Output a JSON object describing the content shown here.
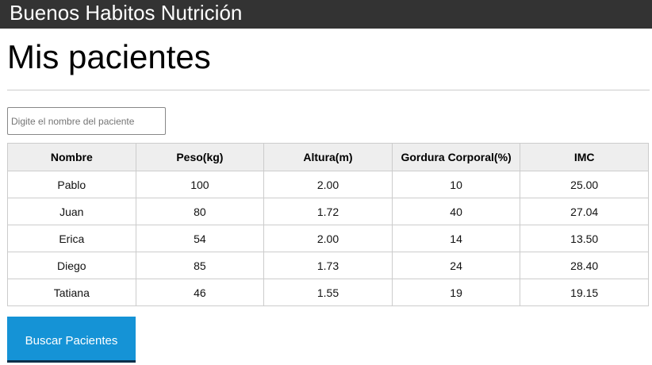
{
  "header": {
    "brand": "Buenos Habitos Nutrición"
  },
  "page": {
    "title": "Mis pacientes"
  },
  "search": {
    "placeholder": "Digite el nombre del paciente",
    "value": ""
  },
  "table": {
    "headers": [
      "Nombre",
      "Peso(kg)",
      "Altura(m)",
      "Gordura Corporal(%)",
      "IMC"
    ],
    "rows": [
      [
        "Pablo",
        "100",
        "2.00",
        "10",
        "25.00"
      ],
      [
        "Juan",
        "80",
        "1.72",
        "40",
        "27.04"
      ],
      [
        "Erica",
        "54",
        "2.00",
        "14",
        "13.50"
      ],
      [
        "Diego",
        "85",
        "1.73",
        "24",
        "28.40"
      ],
      [
        "Tatiana",
        "46",
        "1.55",
        "19",
        "19.15"
      ]
    ]
  },
  "actions": {
    "search_button_label": "Buscar Pacientes"
  },
  "colors": {
    "header_bg": "#333333",
    "button_bg": "#1593d6",
    "table_header_bg": "#eeeeee"
  }
}
